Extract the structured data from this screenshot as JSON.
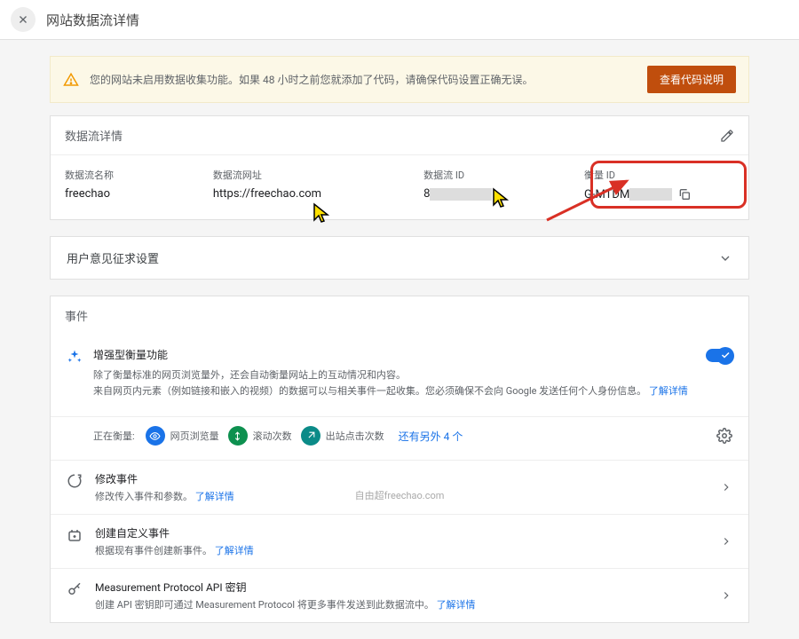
{
  "topbar": {
    "title": "网站数据流详情"
  },
  "alert": {
    "text": "您的网站未启用数据收集功能。如果 48 小时之前您就添加了代码，请确保代码设置正确无误。",
    "button": "查看代码说明"
  },
  "details_card": {
    "header": "数据流详情",
    "fields": {
      "stream_name_label": "数据流名称",
      "stream_name_value": "freechao",
      "stream_url_label": "数据流网址",
      "stream_url_value": "https://freechao.com",
      "stream_id_label": "数据流 ID",
      "stream_id_prefix": "8",
      "measurement_id_label": "衡量 ID",
      "measurement_id_prefix": "G-MTDM"
    }
  },
  "feedback_card": {
    "header": "用户意见征求设置"
  },
  "events_card": {
    "header": "事件",
    "enhanced": {
      "title": "增强型衡量功能",
      "desc1": "除了衡量标准的网页浏览量外，还会自动衡量网站上的互动情况和内容。",
      "desc2_a": "来自网页内元素（例如链接和嵌入的视频）的数据可以与相关事件一起收集。您必须确保不会向 Google 发送任何个人身份信息。",
      "learn_more": "了解详情"
    },
    "measuring": {
      "label": "正在衡量:",
      "pill1": "网页浏览量",
      "pill2": "滚动次数",
      "pill3": "出站点击次数",
      "more": "还有另外 4 个"
    },
    "rows": {
      "modify": {
        "title": "修改事件",
        "desc_a": "修改传入事件和参数。",
        "link": "了解详情"
      },
      "create": {
        "title": "创建自定义事件",
        "desc_a": "根据现有事件创建新事件。",
        "link": "了解详情"
      },
      "mp": {
        "title": "Measurement Protocol API 密钥",
        "desc_a": "创建 API 密钥即可通过 Measurement Protocol 将更多事件发送到此数据流中。",
        "link": "了解详情"
      }
    }
  },
  "watermark": "自由超freechao.com"
}
